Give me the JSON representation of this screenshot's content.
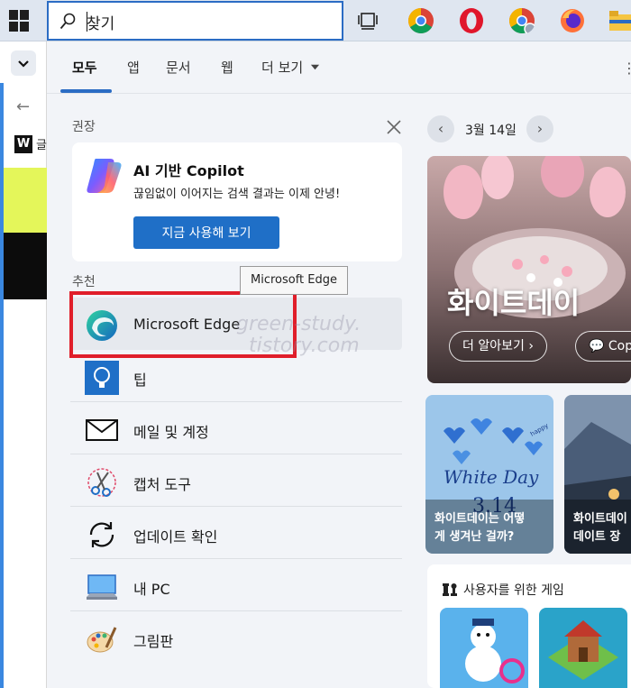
{
  "taskbar": {
    "search_value": "찾기",
    "icons": [
      "windows-logo",
      "task-view-icon",
      "chrome-icon",
      "opera-icon",
      "chrome-profile-icon",
      "firefox-icon",
      "file-explorer-icon"
    ]
  },
  "background_window": {
    "text": "글"
  },
  "tabs": [
    {
      "label": "모두",
      "active": true
    },
    {
      "label": "앱"
    },
    {
      "label": "문서"
    },
    {
      "label": "웹"
    },
    {
      "label": "더 보기"
    }
  ],
  "recommended_section": {
    "label": "권장",
    "card": {
      "title": "AI 기반 Copilot",
      "description": "끊임없이 이어지는 검색 결과는 이제 안녕!",
      "button_label": "지금 사용해 보기"
    }
  },
  "suggested_section": {
    "label": "추천",
    "tooltip": "Microsoft Edge",
    "apps": [
      {
        "label": "Microsoft Edge",
        "icon": "edge-icon"
      },
      {
        "label": "팁",
        "icon": "tips-icon"
      },
      {
        "label": "메일 및 계정",
        "icon": "mail-icon"
      },
      {
        "label": "캡처 도구",
        "icon": "snipping-tool-icon"
      },
      {
        "label": "업데이트 확인",
        "icon": "update-icon"
      },
      {
        "label": "내 PC",
        "icon": "this-pc-icon"
      },
      {
        "label": "그림판",
        "icon": "paint-icon"
      }
    ]
  },
  "watermark": {
    "line1": "green-study.",
    "line2": "tistory.com"
  },
  "right_column": {
    "date": "3월 14일",
    "hero": {
      "title": "화이트데이",
      "learn_more": "더 알아보기",
      "copilot_btn": "Cop"
    },
    "cards": [
      {
        "caption_line1": "화이트데이는 어떻",
        "caption_line2": "게 생겨난 걸까?",
        "art_text": "White Day",
        "art_text2": "3.14",
        "art_text3": "happy"
      },
      {
        "caption_line1": "화이트데이",
        "caption_line2": "데이트 장"
      }
    ],
    "games": {
      "title": "사용자를 위한 게임"
    }
  },
  "colors": {
    "accent": "#2b6cc4",
    "button_blue": "#1f6fc7",
    "highlight_red": "#e01e2a"
  }
}
